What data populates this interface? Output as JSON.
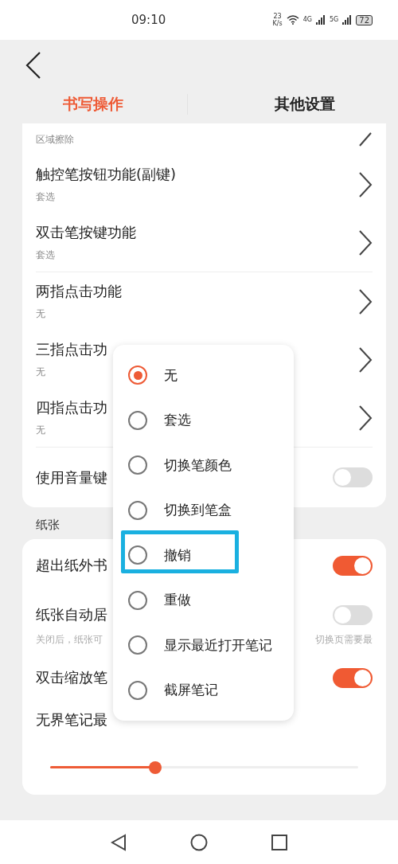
{
  "status_bar": {
    "time": "09:10",
    "speed_value": "23",
    "speed_unit": "K/s",
    "network_1": "4G",
    "network_2": "5G",
    "battery": "72"
  },
  "tabs": [
    {
      "label": "书写操作",
      "selected": true
    },
    {
      "label": "其他设置",
      "selected": false
    }
  ],
  "writing_card": {
    "groups": [
      [
        {
          "kind": "nav",
          "subtitle": "区域擦除",
          "cut": true
        },
        {
          "kind": "nav",
          "title": "触控笔按钮功能(副键)",
          "subtitle": "套选"
        },
        {
          "kind": "nav",
          "title": "双击笔按键功能",
          "subtitle": "套选"
        }
      ],
      [
        {
          "kind": "nav",
          "title": "两指点击功能",
          "subtitle": "无"
        },
        {
          "kind": "nav",
          "title": "三指点击功",
          "subtitle": "无"
        },
        {
          "kind": "nav",
          "title": "四指点击功",
          "subtitle": "无"
        }
      ],
      [
        {
          "kind": "toggle",
          "title": "使用音量键",
          "on": false
        }
      ]
    ]
  },
  "paper_section": {
    "title": "纸张",
    "rows": [
      {
        "kind": "toggle",
        "title": "超出纸外书",
        "on": true
      },
      {
        "kind": "toggle",
        "title": "纸张自动居",
        "on": false,
        "note_left": "关闭后，纸张可",
        "note_right": "切换页需要最"
      },
      {
        "kind": "toggle",
        "title": "双击缩放笔",
        "on": true
      },
      {
        "kind": "slider",
        "title": "无界笔记最",
        "level": 0.34
      }
    ]
  },
  "popup": {
    "options": [
      {
        "label": "无",
        "selected": true
      },
      {
        "label": "套选",
        "selected": false
      },
      {
        "label": "切换笔颜色",
        "selected": false
      },
      {
        "label": "切换到笔盒",
        "selected": false
      },
      {
        "label": "撤销",
        "selected": false,
        "highlighted": true
      },
      {
        "label": "重做",
        "selected": false
      },
      {
        "label": "显示最近打开笔记",
        "selected": false
      },
      {
        "label": "截屏笔记",
        "selected": false
      }
    ]
  }
}
